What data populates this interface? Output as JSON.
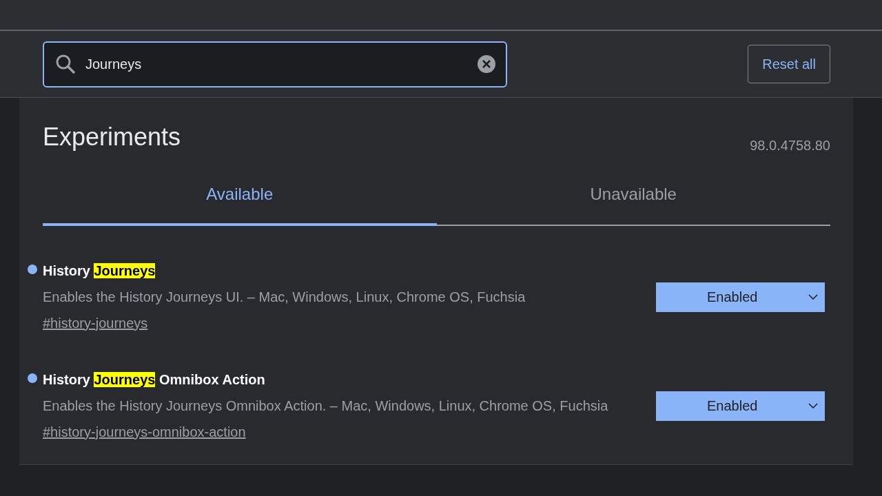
{
  "search": {
    "value": "Journeys"
  },
  "reset_button": "Reset all",
  "title": "Experiments",
  "version": "98.0.4758.80",
  "tabs": [
    {
      "label": "Available",
      "selected": true
    },
    {
      "label": "Unavailable",
      "selected": false
    }
  ],
  "experiments": [
    {
      "modified": true,
      "title": [
        {
          "text": "History ",
          "highlighted": false
        },
        {
          "text": "Journeys",
          "highlighted": true
        }
      ],
      "description": "Enables the History Journeys UI. – Mac, Windows, Linux, Chrome OS, Fuchsia",
      "link": "#history-journeys",
      "value": "Enabled"
    },
    {
      "modified": true,
      "title": [
        {
          "text": "History ",
          "highlighted": false
        },
        {
          "text": "Journeys",
          "highlighted": true
        },
        {
          "text": " Omnibox Action",
          "highlighted": false
        }
      ],
      "description": "Enables the History Journeys Omnibox Action. – Mac, Windows, Linux, Chrome OS, Fuchsia",
      "link": "#history-journeys-omnibox-action",
      "value": "Enabled"
    }
  ]
}
